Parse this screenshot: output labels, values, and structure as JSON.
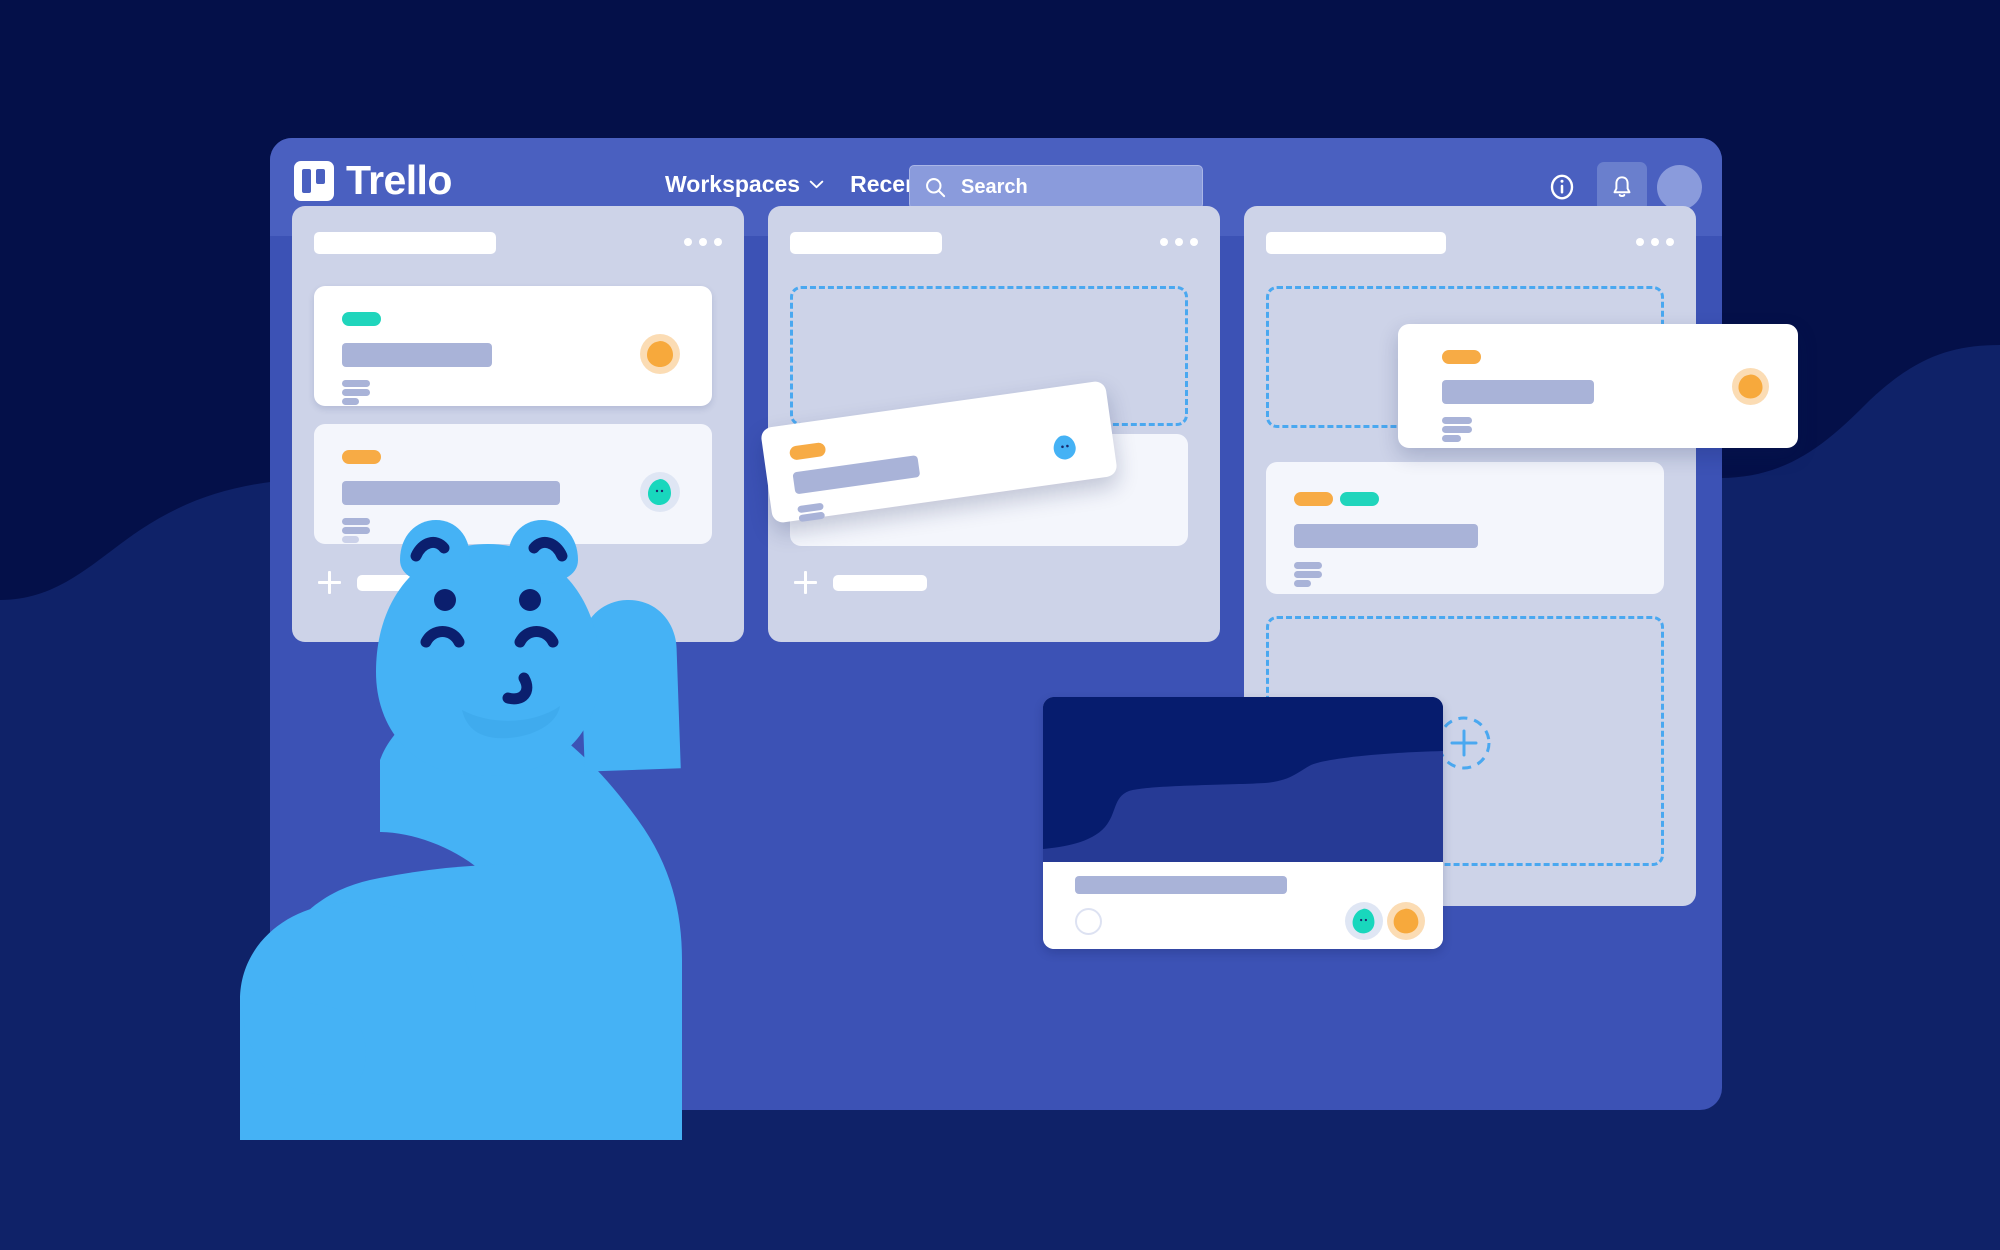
{
  "app": {
    "brand_name": "Trello",
    "brand_icon": "trello-board-logo-icon"
  },
  "topnav": {
    "items": [
      {
        "label": "Workspaces",
        "icon": "chevron-down-icon"
      },
      {
        "label": "Recent",
        "icon": "chevron-down-icon"
      }
    ],
    "search": {
      "placeholder": "Search",
      "icon": "search-icon"
    },
    "actions": [
      {
        "name": "info-icon",
        "label": "i"
      },
      {
        "name": "notifications-bell-icon",
        "label": ""
      },
      {
        "name": "user-avatar",
        "label": ""
      }
    ]
  },
  "board": {
    "lists": [
      {
        "name": "list-one",
        "header_placeholder": "",
        "menu_icon": "more-options-icon",
        "cards": [
          {
            "name": "card-1",
            "style": "white",
            "labels": [
              "teal"
            ],
            "title_placeholder": "",
            "lines": 3,
            "avatar": "orange"
          },
          {
            "name": "card-2",
            "style": "muted",
            "labels": [
              "orange"
            ],
            "title_placeholder": "",
            "lines": 3,
            "avatar": "teal"
          }
        ],
        "add_card_label": ""
      },
      {
        "name": "list-two",
        "header_placeholder": "",
        "menu_icon": "more-options-icon",
        "dropzone": true,
        "cards": [
          {
            "name": "card-3",
            "style": "muted",
            "labels": [],
            "title_placeholder": "",
            "lines": 0,
            "avatar": null
          }
        ],
        "add_card_label": ""
      },
      {
        "name": "list-three",
        "header_placeholder": "",
        "menu_icon": "more-options-icon",
        "dropzone": true,
        "cards": [
          {
            "name": "card-4",
            "style": "muted",
            "labels": [
              "orange",
              "teal"
            ],
            "title_placeholder": "",
            "lines": 3,
            "avatar": null
          }
        ],
        "add_card_label": ""
      }
    ]
  },
  "dragged_card": {
    "name": "dragged-card",
    "labels": [
      "orange"
    ],
    "lines": 3,
    "avatar": "blue"
  },
  "floating_card": {
    "name": "floating-card",
    "labels": [
      "orange"
    ],
    "lines": 3,
    "avatar": "orange"
  },
  "media_card": {
    "name": "media-cover-card",
    "cover": "abstract-navy-waves",
    "title_placeholder": "",
    "checkbox_icon": "circle-checkbox-icon",
    "avatars": [
      "teal",
      "orange"
    ]
  },
  "mascot": {
    "name": "taco-hippo-mascot",
    "pose": "holding-card-raised-arm"
  },
  "colors": {
    "page_background": "#041049",
    "page_wave": "#0f2268",
    "board": "#3c52b5",
    "topbar": "#4a60c0",
    "list": "#cdd3e8",
    "card_white": "#ffffff",
    "card_muted": "#f4f6fc",
    "placeholder": "#a9b3d8",
    "label_teal": "#20d5bc",
    "label_orange": "#f7ab45",
    "dropzone_border": "#4aa8f0",
    "mascot_blue": "#45b2f5",
    "mascot_navy": "#0b1f6e",
    "avatar_orange": "#f7a93c",
    "avatar_orange_bg": "#fbdcb4",
    "avatar_teal": "#18d7bd",
    "avatar_teal_bg": "#dfe6f4",
    "media_cover_dark": "#061c6e",
    "media_cover_mid": "#263a95"
  }
}
